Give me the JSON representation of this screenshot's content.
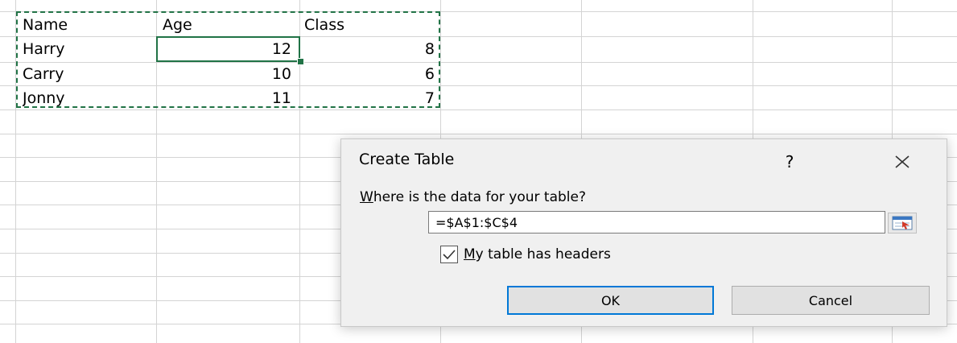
{
  "sheet": {
    "headers": [
      "Name",
      "Age",
      "Class"
    ],
    "rows": [
      [
        "Harry",
        "12",
        "8"
      ],
      [
        "Carry",
        "10",
        "6"
      ],
      [
        "Jonny",
        "11",
        "7"
      ]
    ]
  },
  "dialog": {
    "title": "Create Table",
    "help_glyph": "?",
    "prompt_prefix": "W",
    "prompt_rest": "here is the data for your table?",
    "range_value": "=$A$1:$C$4",
    "checkbox_checked": true,
    "checkbox_prefix": "M",
    "checkbox_rest": "y table has headers",
    "ok_label": "OK",
    "cancel_label": "Cancel"
  },
  "colors": {
    "selection_green": "#217346",
    "ok_focus_blue": "#0078d7",
    "dialog_bg": "#f0f0f0",
    "gridline": "#d4d4d4"
  },
  "icons": {
    "close": "close-icon",
    "collapse": "collapse-dialog-icon",
    "check": "check-icon"
  }
}
